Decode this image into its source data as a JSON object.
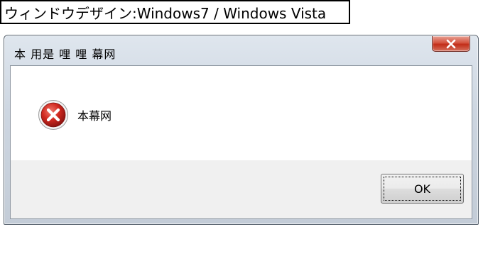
{
  "caption": {
    "text": "ウィンドウデザイン:Windows7 / Windows Vista"
  },
  "window": {
    "title": "本 用是 哩 哩 幕网",
    "close_icon": "close-x-icon",
    "message": {
      "icon": "error-icon",
      "text": "本幕网"
    },
    "buttons": {
      "ok_label": "OK"
    }
  },
  "colors": {
    "error_red": "#c8231e",
    "close_red": "#c22d18",
    "frame": "#cdd6e1"
  }
}
